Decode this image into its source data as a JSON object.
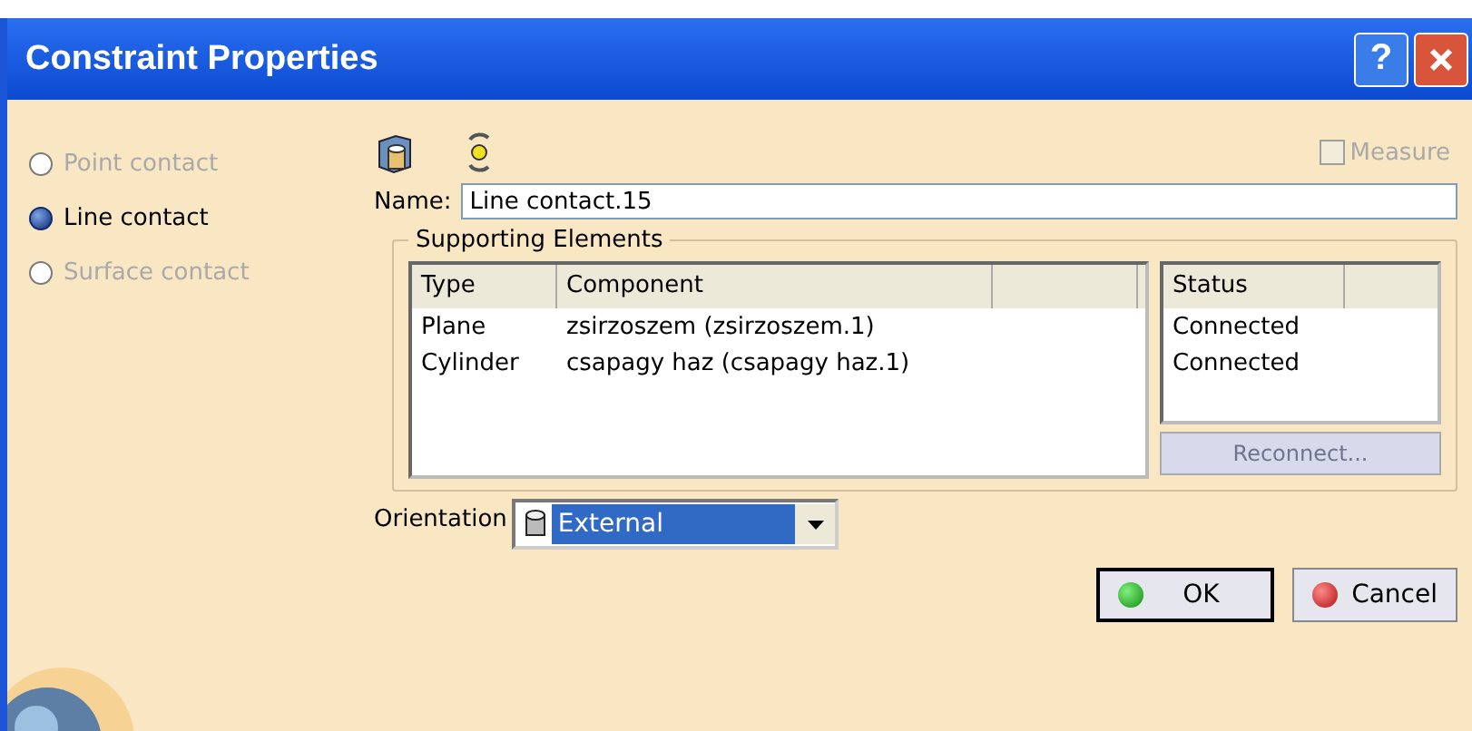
{
  "window": {
    "title": "Constraint Properties",
    "buttons": [
      "?"
    ]
  },
  "contact_types": [
    {
      "label": "Point contact",
      "selected": false,
      "disabled": true
    },
    {
      "label": "Line contact",
      "selected": true,
      "disabled": false
    },
    {
      "label": "Surface contact",
      "selected": false,
      "disabled": true
    }
  ],
  "measure": {
    "label": "Measure",
    "checked": false,
    "disabled": true
  },
  "name": {
    "label": "Name:",
    "value": "Line contact.15"
  },
  "supporting_elements": {
    "title": "Supporting Elements",
    "columns": [
      "Type",
      "Component"
    ],
    "rows": [
      {
        "type": "Plane",
        "component": "zsirzoszem (zsirzoszem.1)"
      },
      {
        "type": "Cylinder",
        "component": "csapagy haz (csapagy haz.1)"
      }
    ],
    "status_column": "Status",
    "statuses": [
      "Connected",
      "Connected"
    ],
    "reconnect": {
      "label": "Reconnect...",
      "disabled": true
    }
  },
  "orientation": {
    "label": "Orientation",
    "value": "External"
  },
  "buttons": [
    {
      "label": "OK",
      "kind": "ok"
    },
    {
      "label": "Cancel",
      "kind": "cancel"
    }
  ]
}
